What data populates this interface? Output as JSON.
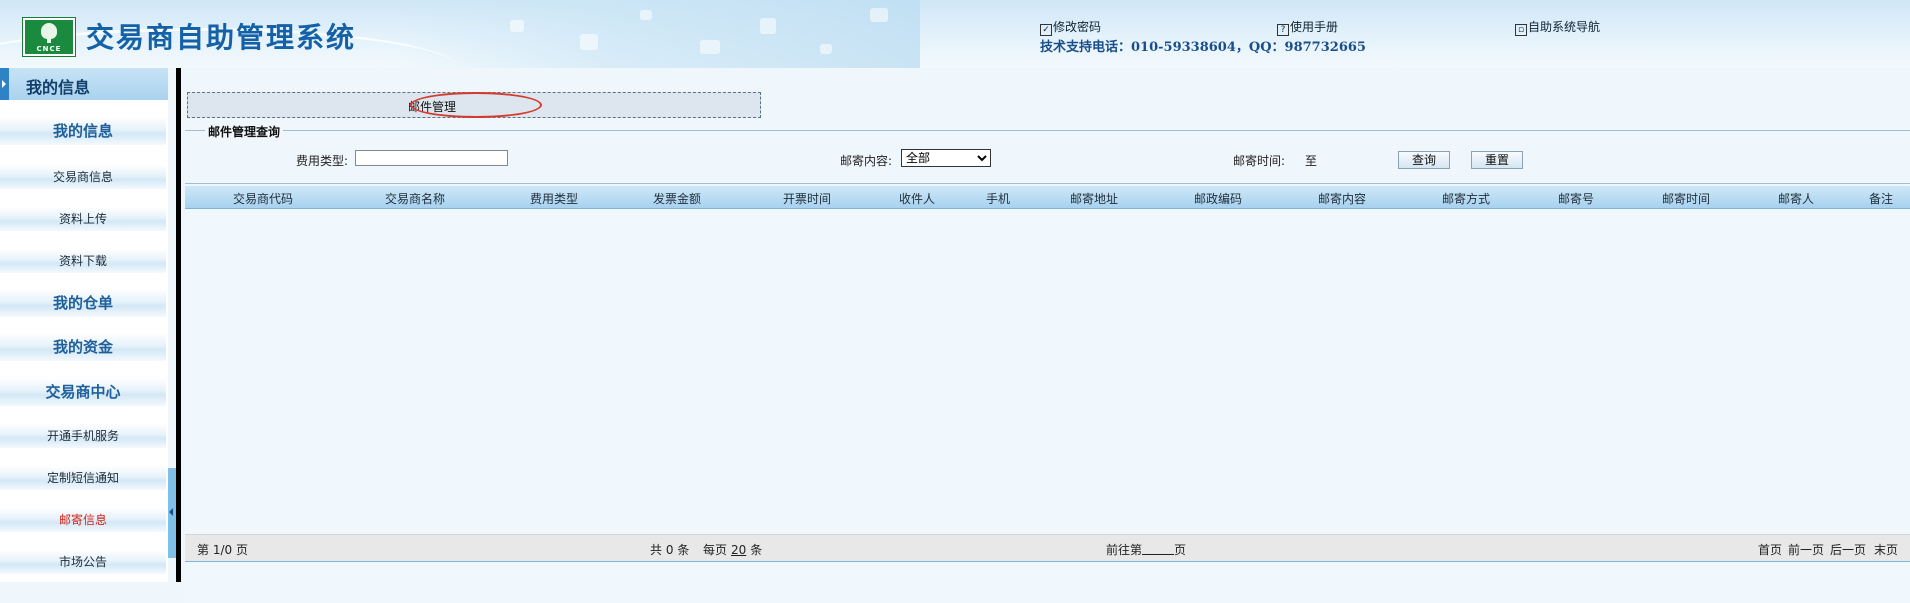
{
  "header": {
    "logo_text": "CNCE",
    "title": "交易商自助管理系统",
    "links": [
      {
        "icon": "checkbox-icon",
        "label": "修改密码"
      },
      {
        "icon": "manual-icon",
        "label": "使用手册"
      },
      {
        "icon": "nav-icon",
        "label": "自助系统导航"
      }
    ],
    "support": "技术支持电话：010-59338604，QQ：987732665"
  },
  "sidebar": {
    "header": "我的信息",
    "items": [
      {
        "label": "我的信息",
        "type": "category"
      },
      {
        "label": "交易商信息",
        "type": "sub"
      },
      {
        "label": "资料上传",
        "type": "sub"
      },
      {
        "label": "资料下载",
        "type": "sub"
      },
      {
        "label": "我的仓单",
        "type": "category"
      },
      {
        "label": "我的资金",
        "type": "category"
      },
      {
        "label": "交易商中心",
        "type": "category"
      },
      {
        "label": "开通手机服务",
        "type": "sub"
      },
      {
        "label": "定制短信通知",
        "type": "sub"
      },
      {
        "label": "邮寄信息",
        "type": "sub",
        "active": true
      },
      {
        "label": "市场公告",
        "type": "sub"
      }
    ]
  },
  "main": {
    "breadcrumb": "邮件管理",
    "query": {
      "legend": "邮件管理查询",
      "fee_type_label": "费用类型:",
      "fee_type_value": "",
      "mail_content_label": "邮寄内容:",
      "mail_content_value": "全部",
      "mail_time_label": "邮寄时间:",
      "mail_time_to": "至",
      "search_button": "查询",
      "reset_button": "重置"
    },
    "table": {
      "columns": [
        "交易商代码",
        "交易商名称",
        "费用类型",
        "发票金额",
        "开票时间",
        "收件人",
        "手机",
        "邮寄地址",
        "邮政编码",
        "邮寄内容",
        "邮寄方式",
        "邮寄号",
        "邮寄时间",
        "邮寄人",
        "备注"
      ],
      "rows": []
    },
    "pager": {
      "page_info": "第 1/0 页",
      "total_prefix": "共",
      "total_count": "0",
      "total_suffix": "条",
      "per_page_prefix": "每页",
      "per_page": "20",
      "per_page_suffix": "条",
      "goto_prefix": "前往第",
      "goto_suffix": "页",
      "first": "首页",
      "prev": "前一页",
      "next": "后一页",
      "last": "末页"
    }
  },
  "colors": {
    "title_blue": "#1461a8",
    "active_red": "#d2231b",
    "header_bg": "#cfe7f7",
    "logo_green": "#1a8a3e"
  }
}
